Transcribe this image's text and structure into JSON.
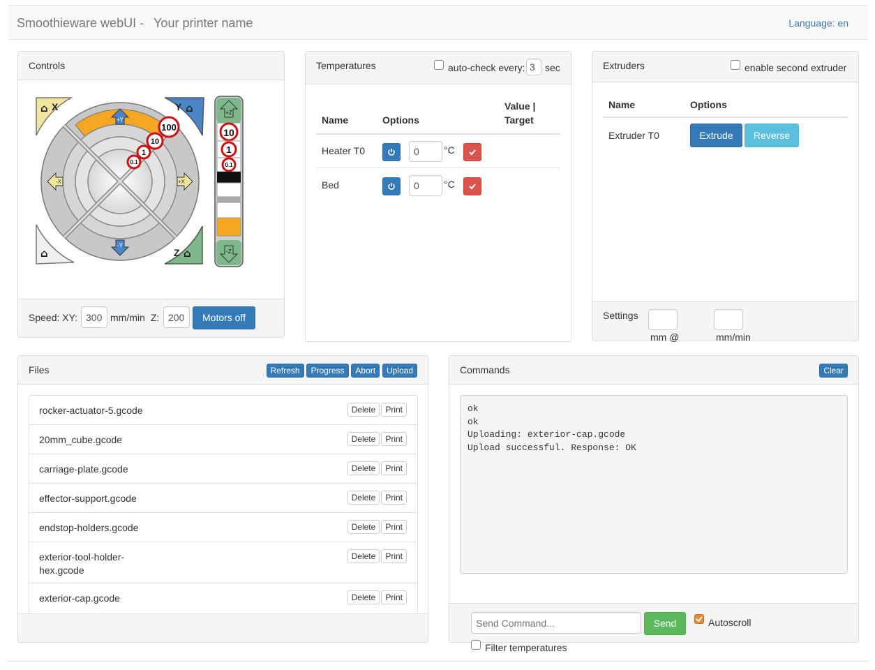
{
  "navbar": {
    "brand": "Smoothieware webUI -",
    "printer_name": "Your printer name",
    "language": "Language: en"
  },
  "controls": {
    "title": "Controls",
    "jog_labels": {
      "home_x": "X",
      "home_y": "Y",
      "home_z": "Z",
      "plus_y": "+Y",
      "minus_y": "-Y",
      "plus_x": "+X",
      "minus_x": "-X",
      "plus_z": "+Z",
      "minus_z": "-Z",
      "step_100": "100",
      "step_10": "10",
      "step_1": "1",
      "step_01": "0.1"
    },
    "speed_label": "Speed: XY:",
    "speed_xy": "300",
    "unit_mmmin": "mm/min",
    "z_label": "Z:",
    "speed_z": "200",
    "motors_off": "Motors off"
  },
  "temperatures": {
    "title": "Temperatures",
    "autocheck_label": "auto-check every:",
    "autocheck_value": "3",
    "autocheck_unit": "sec",
    "autocheck_checked": false,
    "columns": [
      "Name",
      "Options",
      "Value |",
      "Target"
    ],
    "rows": [
      {
        "name": "Heater T0",
        "value": "0",
        "unit": "°C"
      },
      {
        "name": "Bed",
        "value": "0",
        "unit": "°C"
      }
    ]
  },
  "extruders": {
    "title": "Extruders",
    "second_label": "enable second extruder",
    "second_checked": false,
    "columns": [
      "Name",
      "Options"
    ],
    "rows": [
      {
        "name": "Extruder T0",
        "extrude": "Extrude",
        "reverse": "Reverse"
      }
    ],
    "settings_label": "Settings",
    "mm_label": "mm @",
    "mmmin_label": "mm/min",
    "mm_value": "",
    "mmmin_value": ""
  },
  "files": {
    "title": "Files",
    "buttons": {
      "refresh": "Refresh",
      "progress": "Progress",
      "abort": "Abort",
      "upload": "Upload"
    },
    "delete_label": "Delete",
    "print_label": "Print",
    "items": [
      "rocker-actuator-5.gcode",
      "20mm_cube.gcode",
      "carriage-plate.gcode",
      "effector-support.gcode",
      "endstop-holders.gcode",
      "exterior-tool-holder-hex.gcode",
      "exterior-cap.gcode"
    ],
    "item_lines": {
      "exterior-tool-holder-hex.gcode": [
        "exterior-tool-holder-",
        "hex.gcode"
      ]
    }
  },
  "commands": {
    "title": "Commands",
    "clear": "Clear",
    "log": [
      "ok",
      "ok",
      "Uploading: exterior-cap.gcode",
      "Upload successful. Response: OK"
    ],
    "input_placeholder": "Send Command...",
    "send": "Send",
    "autoscroll_label": "Autoscroll",
    "autoscroll_checked": true,
    "filter_label": "Filter temperatures",
    "filter_checked": false
  },
  "colors": {
    "primary": "#337ab7",
    "info": "#5bc0de",
    "success": "#5cb85c",
    "danger": "#d9534f",
    "jog_x_yellow": "#f0e6a0",
    "jog_y_blue": "#4a86c8",
    "jog_z_green": "#7fb88a",
    "jog_arc_orange": "#f5a623"
  }
}
